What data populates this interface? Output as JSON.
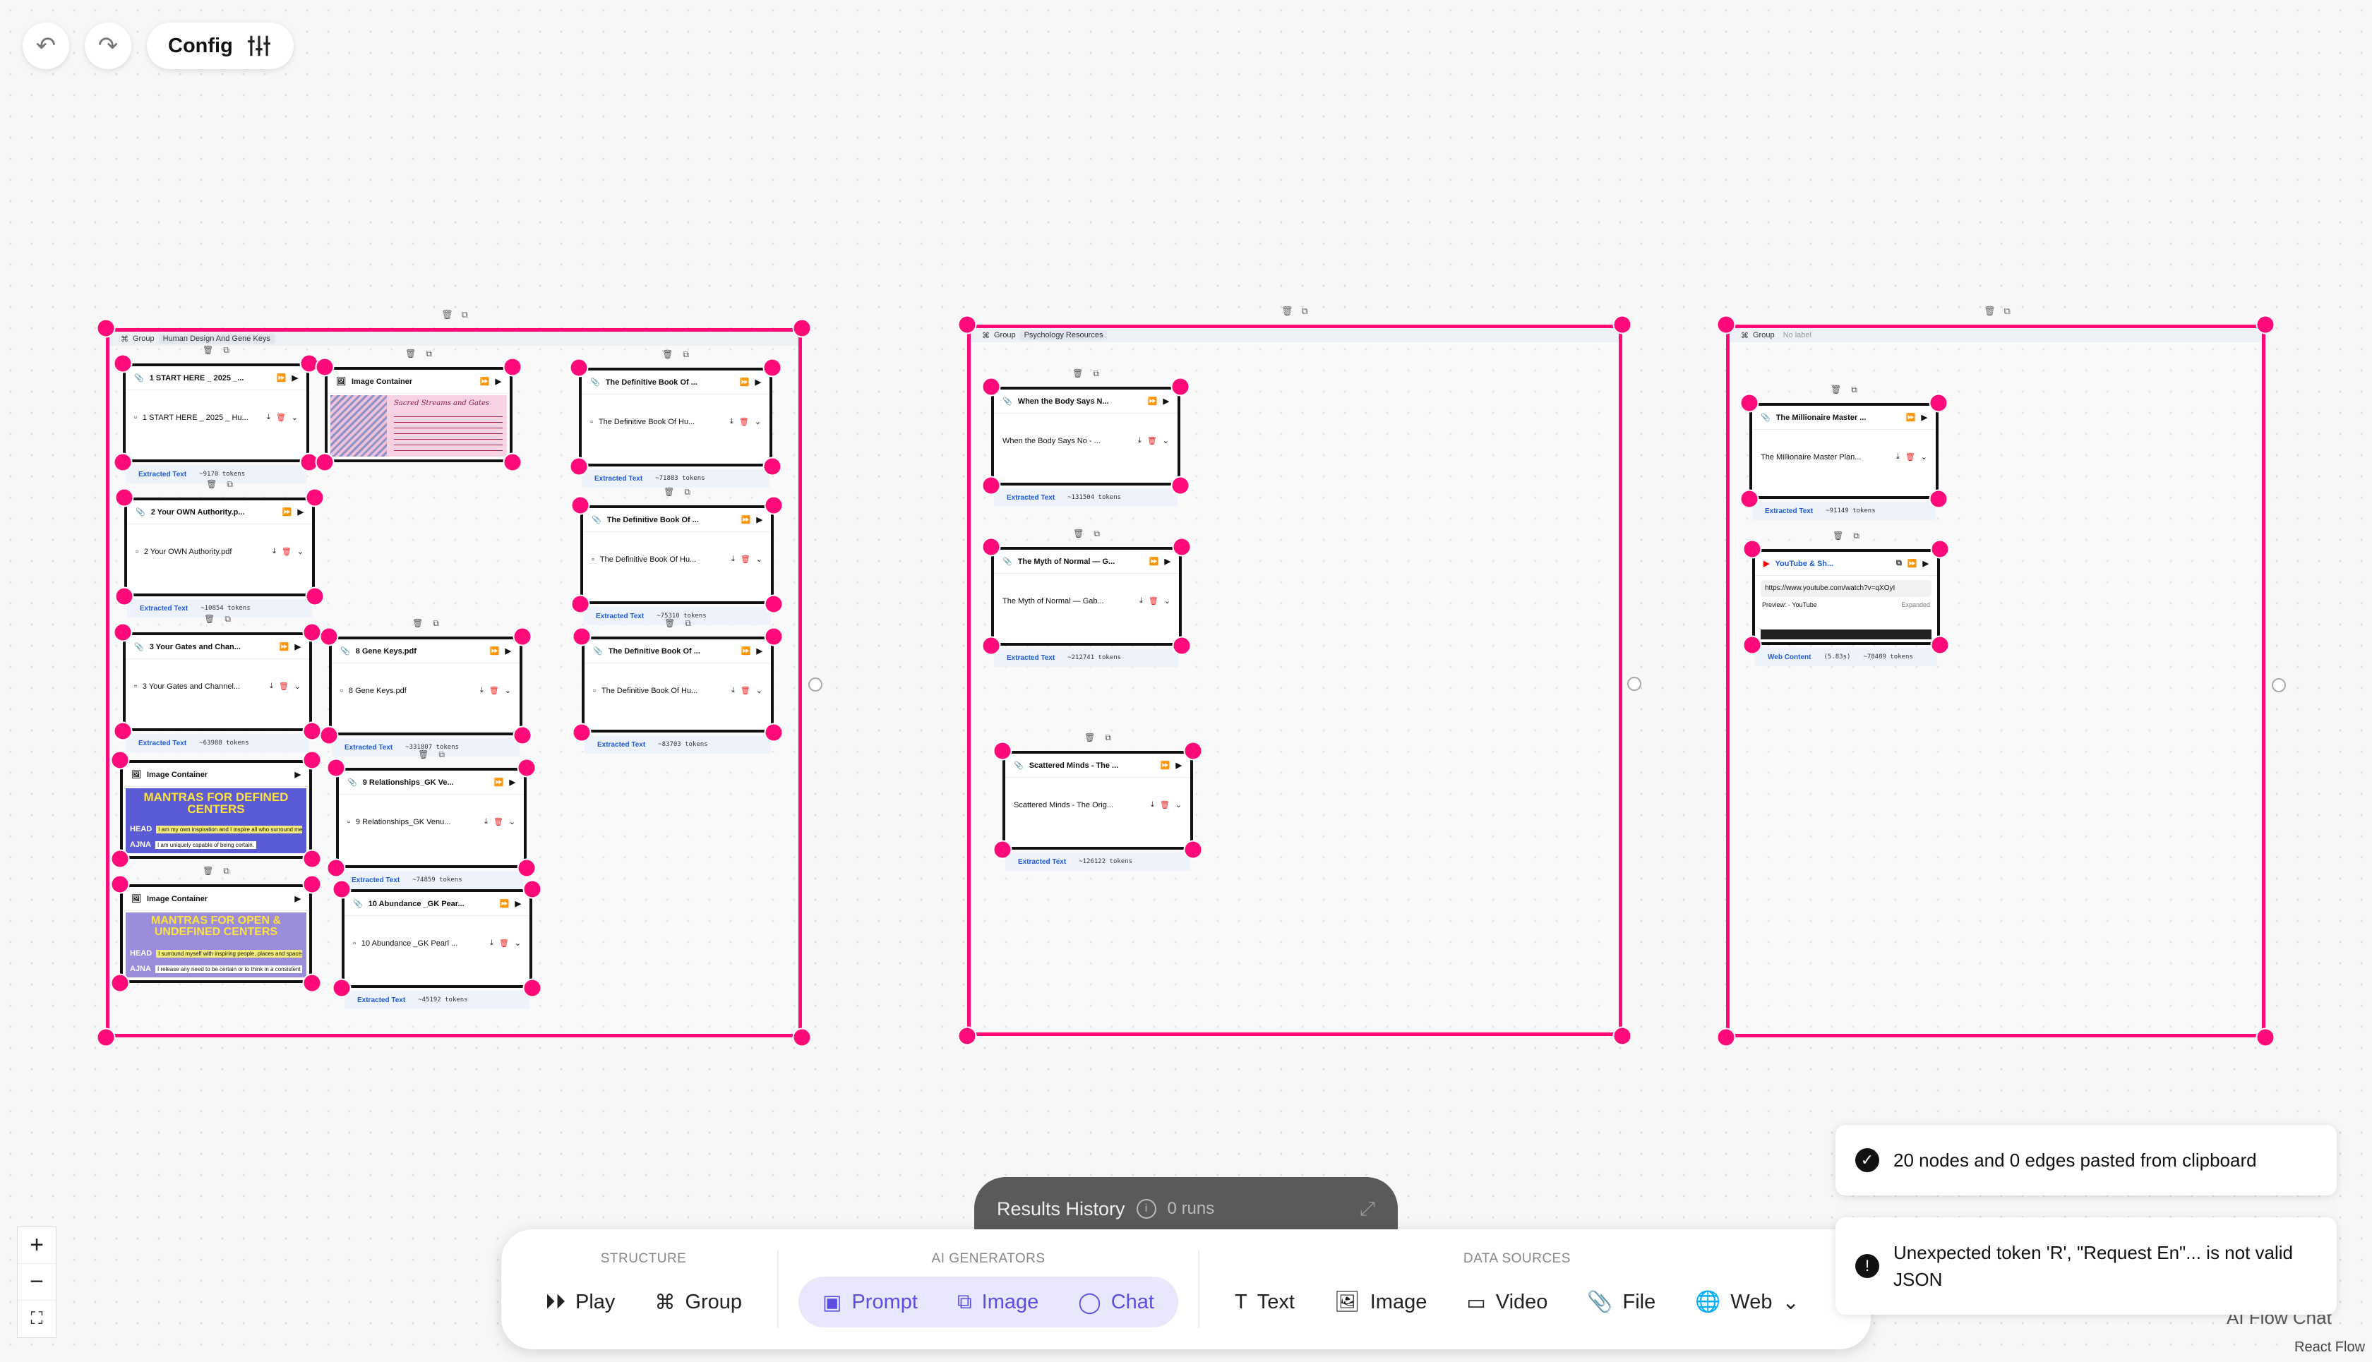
{
  "topbar": {
    "config_label": "Config"
  },
  "groups": [
    {
      "tag": "Group",
      "label": "Human Design And Gene Keys"
    },
    {
      "tag": "Group",
      "label": "Psychology Resources"
    },
    {
      "tag": "Group",
      "label": "No label"
    }
  ],
  "nodes": {
    "n1": {
      "title": "1 START HERE _ 2025 _...",
      "file": "1 START HERE _ 2025 _ Hu...",
      "foot": "Extracted Text",
      "tokens": "~9170 tokens"
    },
    "n2": {
      "title": "Image Container"
    },
    "n3": {
      "title": "The Definitive Book Of ...",
      "file": "The Definitive Book Of Hu...",
      "foot": "Extracted Text",
      "tokens": "~71883 tokens"
    },
    "n4": {
      "title": "2 Your OWN Authority.p...",
      "file": "2 Your OWN Authority.pdf",
      "foot": "Extracted Text",
      "tokens": "~10854 tokens"
    },
    "n5": {
      "title": "The Definitive Book Of ...",
      "file": "The Definitive Book Of Hu...",
      "foot": "Extracted Text",
      "tokens": "~75310 tokens"
    },
    "n6": {
      "title": "3 Your Gates and Chan...",
      "file": "3 Your Gates and Channel...",
      "foot": "Extracted Text",
      "tokens": "~63988 tokens"
    },
    "n7": {
      "title": "8 Gene Keys.pdf",
      "file": "8 Gene Keys.pdf",
      "foot": "Extracted Text",
      "tokens": "~331807 tokens"
    },
    "n8": {
      "title": "The Definitive Book Of ...",
      "file": "The Definitive Book Of Hu...",
      "foot": "Extracted Text",
      "tokens": "~83703 tokens"
    },
    "n9": {
      "title": "Image Container"
    },
    "n10": {
      "title": "9 Relationships_GK Ve...",
      "file": "9 Relationships_GK Venu...",
      "foot": "Extracted Text",
      "tokens": "~74859 tokens"
    },
    "n11": {
      "title": "Image Container"
    },
    "n12": {
      "title": "10 Abundance _GK Pear...",
      "file": "10 Abundance _GK Pearl ...",
      "foot": "Extracted Text",
      "tokens": "~45192 tokens"
    },
    "p1": {
      "title": "When the Body Says N...",
      "file": "When the Body Says No - ...",
      "foot": "Extracted Text",
      "tokens": "~131504 tokens"
    },
    "p2": {
      "title": "The Myth of Normal — G...",
      "file": "The Myth of Normal — Gab...",
      "foot": "Extracted Text",
      "tokens": "~212741 tokens"
    },
    "p3": {
      "title": "Scattered Minds - The ...",
      "file": "Scattered Minds - The Orig...",
      "foot": "Extracted Text",
      "tokens": "~126122 tokens"
    },
    "m1": {
      "title": "The Millionaire Master ...",
      "file": "The Millionaire Master Plan...",
      "foot": "Extracted Text",
      "tokens": "~91149 tokens"
    },
    "m2": {
      "title": "YouTube & Sh...",
      "url": "https://www.youtube.com/watch?v=qXOyI",
      "preview": "Preview: - YouTube",
      "expanded": "Expanded",
      "foot": "Web Content",
      "time": "(5.83s)",
      "tokens": "~78489 tokens"
    }
  },
  "images": {
    "poster1": {
      "title": "Sacred Streams and Gates"
    },
    "poster2": {
      "title": "MANTRAS FOR DEFINED CENTERS",
      "r1k": "HEAD",
      "r1v": "I am my own inspiration and I inspire all who surround me!",
      "r2k": "AJNA",
      "r2v": "I am uniquely capable of being certain."
    },
    "poster3": {
      "title": "MANTRAS FOR OPEN & UNDEFINED CENTERS",
      "r1k": "HEAD",
      "r1v": "I surround myself with inspiring people, places and spaces.",
      "r2k": "AJNA",
      "r2v": "I release any need to be certain or to think in a consistent way."
    }
  },
  "results": {
    "label": "Results History",
    "runs": "0 runs"
  },
  "toolbar": {
    "structure": {
      "title": "STRUCTURE",
      "play": "Play",
      "group": "Group"
    },
    "ai": {
      "title": "AI GENERATORS",
      "prompt": "Prompt",
      "image": "Image",
      "chat": "Chat"
    },
    "data": {
      "title": "DATA SOURCES",
      "text": "Text",
      "image": "Image",
      "video": "Video",
      "file": "File",
      "web": "Web"
    }
  },
  "toasts": {
    "success": "20 nodes and 0 edges pasted from clipboard",
    "error": "Unexpected token 'R', \"Request En\"... is not valid JSON"
  },
  "watermark": "AI Flow Chat",
  "attribution": "React Flow"
}
